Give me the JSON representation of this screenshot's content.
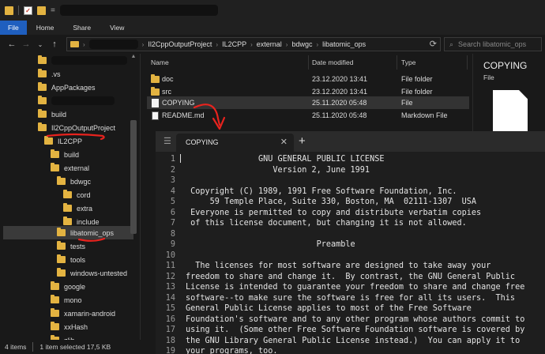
{
  "titlebar": {
    "quick_access_eq": "="
  },
  "ribbon": {
    "tabs": [
      "File",
      "Home",
      "Share",
      "View"
    ]
  },
  "address": {
    "segments": [
      "Il2CppOutputProject",
      "IL2CPP",
      "external",
      "bdwgc",
      "libatomic_ops"
    ]
  },
  "search": {
    "placeholder": "Search libatomic_ops"
  },
  "nav_tree": [
    {
      "label": "",
      "redacted": true
    },
    {
      "label": ".vs"
    },
    {
      "label": "AppPackages"
    },
    {
      "label": "",
      "redacted": true
    },
    {
      "label": "build"
    },
    {
      "label": "Il2CppOutputProject"
    },
    {
      "label": "IL2CPP"
    },
    {
      "label": "build"
    },
    {
      "label": "external"
    },
    {
      "label": "bdwgc"
    },
    {
      "label": "cord"
    },
    {
      "label": "extra"
    },
    {
      "label": "include"
    },
    {
      "label": "libatomic_ops"
    },
    {
      "label": "tests"
    },
    {
      "label": "tools"
    },
    {
      "label": "windows-untested"
    },
    {
      "label": "google"
    },
    {
      "label": "mono"
    },
    {
      "label": "xamarin-android"
    },
    {
      "label": "xxHash"
    },
    {
      "label": "zlib"
    }
  ],
  "columns": {
    "name": "Name",
    "date": "Date modified",
    "type": "Type"
  },
  "files": [
    {
      "name": "doc",
      "date": "23.12.2020 13:41",
      "type": "File folder",
      "icon": "folder-icon"
    },
    {
      "name": "src",
      "date": "23.12.2020 13:41",
      "type": "File folder",
      "icon": "folder-icon"
    },
    {
      "name": "COPYING",
      "date": "25.11.2020 05:48",
      "type": "File",
      "icon": "file-icon"
    },
    {
      "name": "README.md",
      "date": "25.11.2020 05:48",
      "type": "Markdown File",
      "icon": "markdown-file-icon"
    }
  ],
  "preview": {
    "title": "COPYING",
    "subtitle": "File"
  },
  "status": {
    "items": "4 items",
    "selected": "1 item selected  17,5 KB"
  },
  "editor": {
    "tab_title": "COPYING",
    "close_glyph": "✕",
    "new_tab_glyph": "+",
    "lines": [
      "               GNU GENERAL PUBLIC LICENSE",
      "                  Version 2, June 1991",
      "",
      " Copyright (C) 1989, 1991 Free Software Foundation, Inc.",
      "     59 Temple Place, Suite 330, Boston, MA  02111-1307  USA",
      " Everyone is permitted to copy and distribute verbatim copies",
      " of this license document, but changing it is not allowed.",
      "",
      "                           Preamble",
      "",
      "  The licenses for most software are designed to take away your",
      "freedom to share and change it.  By contrast, the GNU General Public",
      "License is intended to guarantee your freedom to share and change free",
      "software--to make sure the software is free for all its users.  This",
      "General Public License applies to most of the Free Software",
      "Foundation's software and to any other program whose authors commit to",
      "using it.  (Some other Free Software Foundation software is covered by",
      "the GNU Library General Public License instead.)  You can apply it to",
      "your programs, too."
    ]
  },
  "colors": {
    "accent_blue": "#1f5fbf",
    "annotation_red": "#e8231e",
    "folder_yellow": "#e3b341"
  }
}
